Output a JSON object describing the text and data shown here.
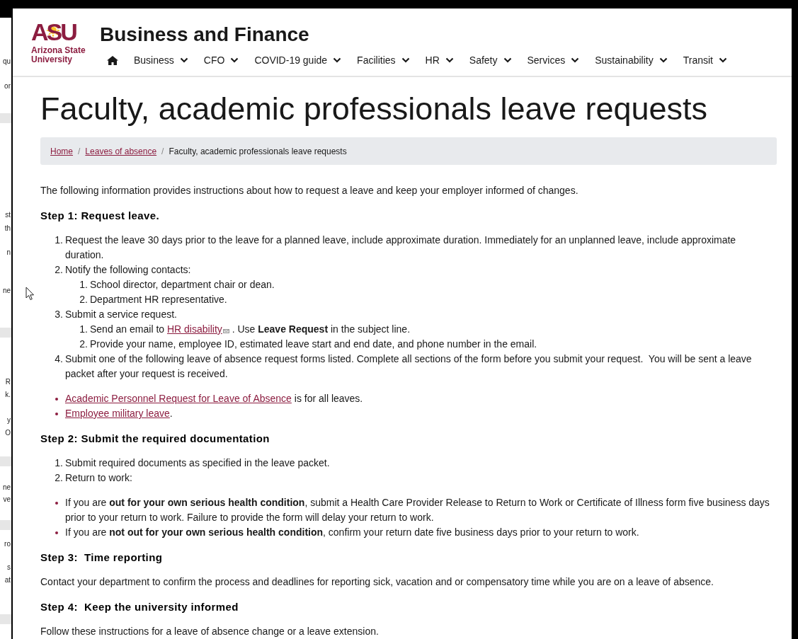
{
  "background_window": {
    "fragments": [
      "qu",
      "or",
      "st",
      "th",
      "n",
      "ne",
      "R",
      "k.",
      "y",
      "O",
      "ne",
      "ve",
      "ro",
      "s",
      "at"
    ]
  },
  "header": {
    "logo": {
      "mark": "ASU",
      "name_lines": [
        "Arizona State",
        "University"
      ]
    },
    "site_title": "Business and Finance",
    "nav": [
      {
        "label": "Business",
        "dropdown": true
      },
      {
        "label": "CFO",
        "dropdown": true
      },
      {
        "label": "COVID-19 guide",
        "dropdown": true
      },
      {
        "label": "Facilities",
        "dropdown": true
      },
      {
        "label": "HR",
        "dropdown": true
      },
      {
        "label": "Safety",
        "dropdown": true
      },
      {
        "label": "Services",
        "dropdown": true
      },
      {
        "label": "Sustainability",
        "dropdown": true
      },
      {
        "label": "Transit",
        "dropdown": true
      }
    ]
  },
  "page_title": "Faculty, academic professionals leave requests",
  "breadcrumb": [
    {
      "label": "Home",
      "link": true
    },
    {
      "separator": "/",
      "label": "Leaves of absence",
      "link": true
    },
    {
      "separator": "/",
      "label": "Faculty, academic professionals leave requests",
      "link": false
    }
  ],
  "content": [
    {
      "kind": "paragraph",
      "parts": [
        {
          "kind": "text",
          "text": "The following information provides instructions about how to request a leave and keep your employer informed of changes."
        }
      ]
    },
    {
      "kind": "heading",
      "text": "Step 1: Request leave."
    },
    {
      "kind": "ordered",
      "items": [
        {
          "marker": "1.",
          "parts": [
            {
              "kind": "text",
              "text": "Request the leave 30 days prior to the leave for a planned leave, include approximate duration. Immediately for an unplanned leave, include approximate duration."
            }
          ]
        },
        {
          "marker": "2.",
          "parts": [
            {
              "kind": "text",
              "text": "Notify the following contacts:"
            }
          ],
          "children": [
            {
              "marker": "1.",
              "parts": [
                {
                  "kind": "text",
                  "text": "School director, department chair or dean."
                }
              ]
            },
            {
              "marker": "2.",
              "parts": [
                {
                  "kind": "text",
                  "text": "Department HR representative."
                }
              ]
            }
          ]
        },
        {
          "marker": "3.",
          "parts": [
            {
              "kind": "text",
              "text": "Submit a service request."
            }
          ],
          "children": [
            {
              "marker": "1.",
              "parts": [
                {
                  "kind": "text",
                  "text": "Send an email to "
                },
                {
                  "kind": "link",
                  "text": "HR disability",
                  "mail_icon": true
                },
                {
                  "kind": "text",
                  "text": " . Use **Leave Request** in the subject line."
                }
              ]
            },
            {
              "marker": "2.",
              "parts": [
                {
                  "kind": "text",
                  "text": "Provide your name, employee ID, estimated leave start and end date, and phone number in the email."
                }
              ]
            }
          ]
        },
        {
          "marker": "4.",
          "parts": [
            {
              "kind": "text",
              "text": "Submit one of the following leave of absence request forms listed. Complete all sections of the form before you submit your request.  You will be sent a leave packet after your request is received."
            }
          ]
        }
      ]
    },
    {
      "kind": "bullets",
      "items": [
        {
          "parts": [
            {
              "kind": "link",
              "text": "Academic Personnel Request for Leave of Absence",
              "mail_icon": false
            },
            {
              "kind": "text",
              "text": " is for all leaves."
            }
          ]
        },
        {
          "parts": [
            {
              "kind": "link",
              "text": "Employee military leave",
              "mail_icon": false
            },
            {
              "kind": "text",
              "text": "."
            }
          ]
        }
      ]
    },
    {
      "kind": "heading",
      "text": "Step 2: Submit the required documentation"
    },
    {
      "kind": "ordered",
      "items": [
        {
          "marker": "1.",
          "parts": [
            {
              "kind": "text",
              "text": "Submit required documents as specified in the leave packet."
            }
          ]
        },
        {
          "marker": "2.",
          "parts": [
            {
              "kind": "text",
              "text": "Return to work:"
            }
          ]
        }
      ]
    },
    {
      "kind": "bullets",
      "items": [
        {
          "parts": [
            {
              "kind": "text",
              "text": "If you are **out for your own serious health condition**, submit a Health Care Provider Release to Return to Work or Certificate of Illness form five business days prior to your return to work. Failure to provide the form will delay your return to work."
            }
          ]
        },
        {
          "parts": [
            {
              "kind": "text",
              "text": "If you are **not out for your own serious health condition**, confirm your return date five business days prior to your return to work."
            }
          ]
        }
      ]
    },
    {
      "kind": "heading",
      "text": "Step 3:  Time reporting"
    },
    {
      "kind": "paragraph",
      "parts": [
        {
          "kind": "text",
          "text": "Contact your department to confirm the process and deadlines for reporting sick, vacation and or compensatory time while you are on a leave of absence."
        }
      ]
    },
    {
      "kind": "heading",
      "text": "Step 4:  Keep the university informed"
    },
    {
      "kind": "paragraph",
      "parts": [
        {
          "kind": "text",
          "text": "Follow these instructions for a leave of absence change or a leave extension."
        }
      ]
    }
  ]
}
